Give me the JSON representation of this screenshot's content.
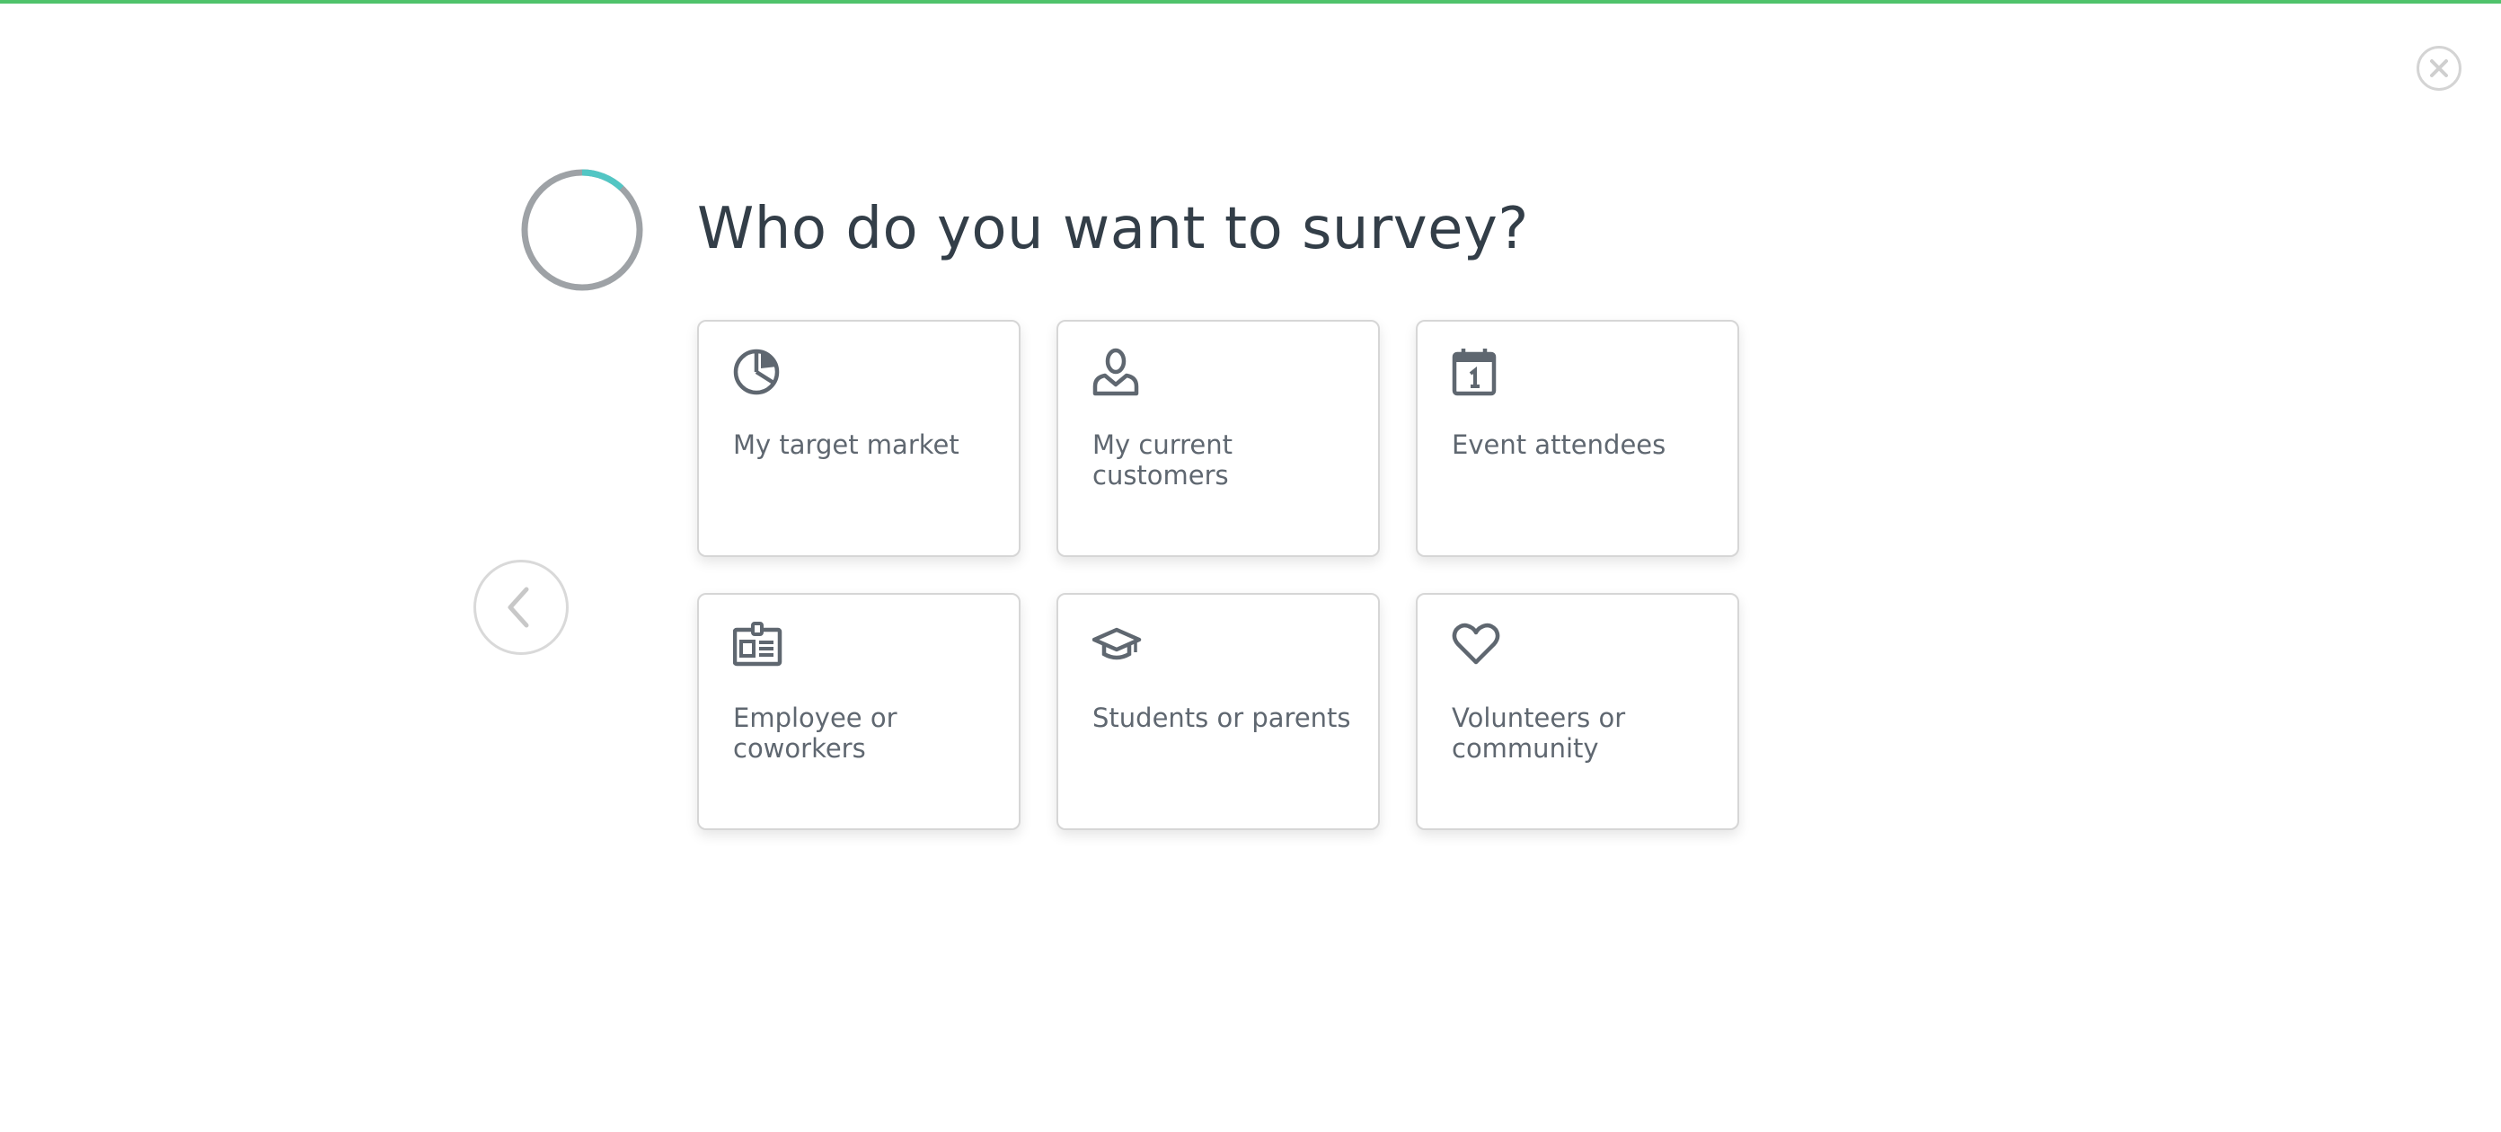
{
  "header": {
    "title": "Who do you want to survey?"
  },
  "progress": {
    "fraction": 0.12
  },
  "colors": {
    "top_bar": "#4fc36b",
    "progress_track": "#9ea2a6",
    "progress_fill": "#52c6c4",
    "text": "#333e48",
    "card_text": "#5f6770"
  },
  "icons": {
    "close": "close-icon",
    "back": "chevron-left-icon"
  },
  "cards": [
    {
      "label": "My target market",
      "icon": "pie-chart-icon"
    },
    {
      "label": "My current customers",
      "icon": "person-icon"
    },
    {
      "label": "Event attendees",
      "icon": "calendar-icon"
    },
    {
      "label": "Employee or coworkers",
      "icon": "id-badge-icon"
    },
    {
      "label": "Students or parents",
      "icon": "graduation-cap-icon"
    },
    {
      "label": "Volunteers or community",
      "icon": "heart-icon"
    }
  ]
}
